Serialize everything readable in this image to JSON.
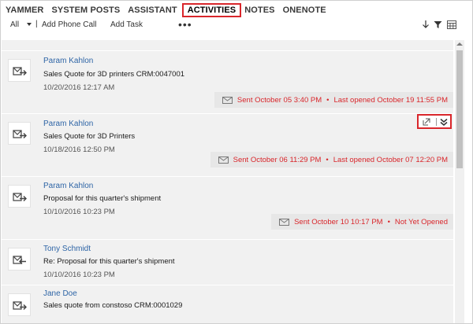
{
  "tabs": [
    {
      "label": "YAMMER",
      "active": false
    },
    {
      "label": "SYSTEM POSTS",
      "active": false
    },
    {
      "label": "ASSISTANT",
      "active": false
    },
    {
      "label": "ACTIVITIES",
      "active": true
    },
    {
      "label": "NOTES",
      "active": false
    },
    {
      "label": "ONENOTE",
      "active": false
    }
  ],
  "toolbar": {
    "filter_value": "All",
    "separator": "|",
    "add_phone_call": "Add Phone Call",
    "add_task": "Add Task",
    "more": "•••"
  },
  "activities": [
    {
      "sender": "Param Kahlon",
      "subject": "Sales Quote for 3D printers CRM:0047001",
      "date": "10/20/2016 12:17 AM",
      "sent": "Sent October 05 3:40 PM",
      "opened": "Last opened October 19 11:55 PM",
      "direction": "outgoing"
    },
    {
      "sender": "Param Kahlon",
      "subject": "Sales Quote for 3D Printers",
      "date": "10/18/2016 12:50 PM",
      "sent": "Sent October 06 11:29 PM",
      "opened": "Last opened October 07 12:20 PM",
      "direction": "outgoing"
    },
    {
      "sender": "Param Kahlon",
      "subject": "Proposal for this quarter's shipment",
      "date": "10/10/2016 10:23 PM",
      "sent": "Sent October 10 10:17 PM",
      "opened": "Not Yet Opened",
      "direction": "outgoing"
    },
    {
      "sender": "Tony Schmidt",
      "subject": "Re: Proposal for this quarter's shipment",
      "date": "10/10/2016 10:23 PM",
      "direction": "incoming"
    },
    {
      "sender": "Jane Doe",
      "subject": "Sales quote from constoso CRM:0001029",
      "direction": "outgoing"
    }
  ],
  "status_separator": "•",
  "colors": {
    "accent_red": "#d9262b",
    "link_blue": "#2e65a6",
    "row_bg": "#f1f1f1",
    "status_bg": "#e7e7e7"
  },
  "icons": {
    "envelope_out": "envelope-arrow-right-icon",
    "envelope_in": "envelope-arrow-left-icon",
    "sort": "arrow-down-icon",
    "filter": "funnel-icon",
    "grid": "grid-view-icon",
    "popout": "popout-icon",
    "expand": "double-chevron-down-icon"
  }
}
